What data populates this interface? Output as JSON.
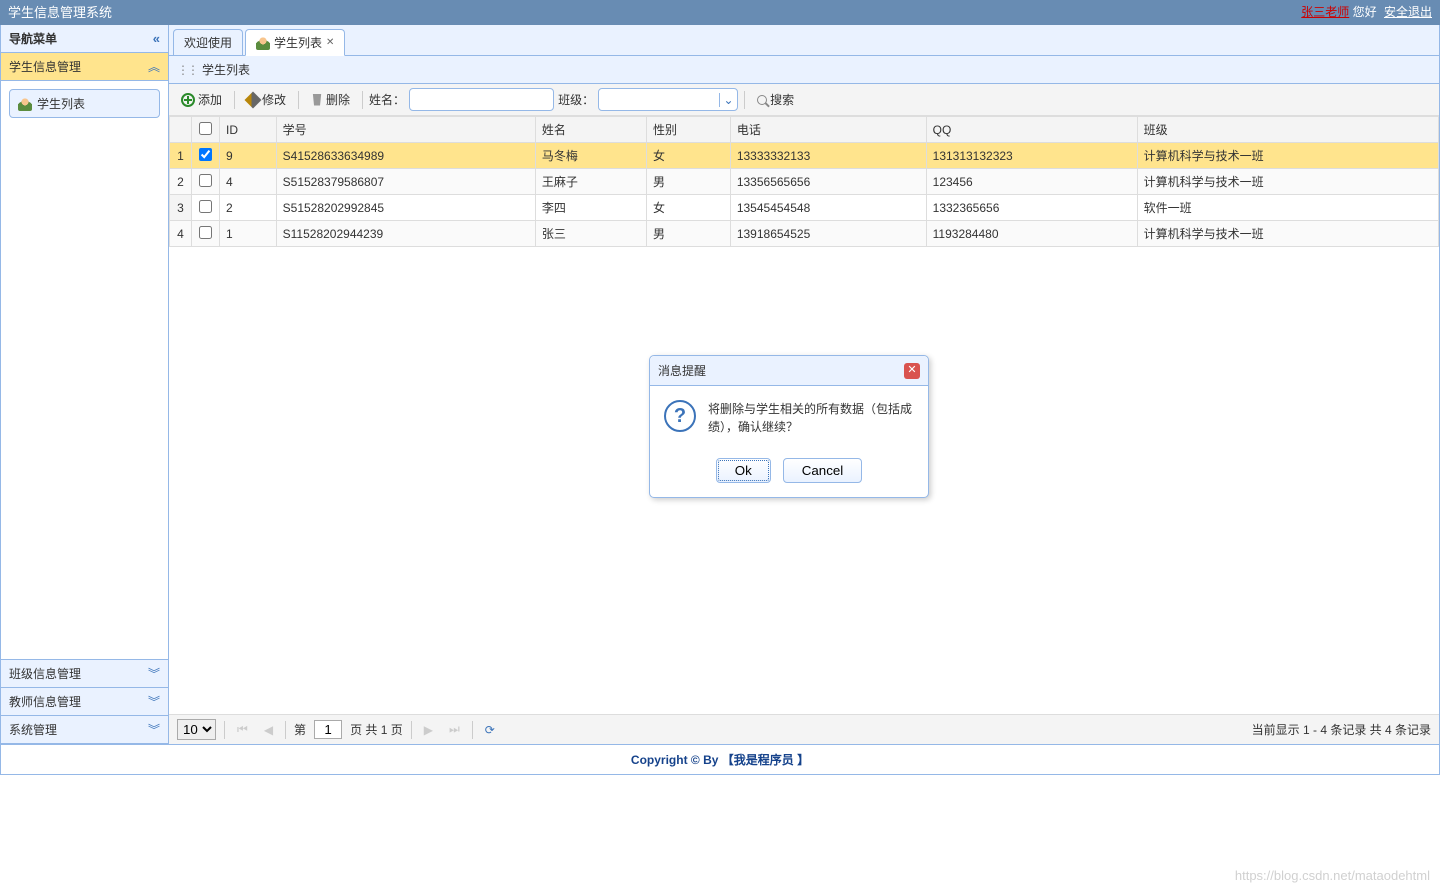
{
  "topbar": {
    "title": "学生信息管理系统",
    "teacher": "张三老师",
    "greeting": "您好",
    "logout": "安全退出"
  },
  "sidebar": {
    "header": "导航菜单",
    "sections": [
      {
        "label": "学生信息管理",
        "expanded": true,
        "items": [
          {
            "label": "学生列表"
          }
        ]
      },
      {
        "label": "班级信息管理",
        "expanded": false
      },
      {
        "label": "教师信息管理",
        "expanded": false
      },
      {
        "label": "系统管理",
        "expanded": false
      }
    ]
  },
  "tabs": {
    "items": [
      {
        "label": "欢迎使用",
        "closable": false,
        "icon": false
      },
      {
        "label": "学生列表",
        "closable": true,
        "icon": true
      }
    ],
    "active": 1
  },
  "panel": {
    "title": "学生列表"
  },
  "toolbar": {
    "add": "添加",
    "edit": "修改",
    "delete": "删除",
    "name_label": "姓名：",
    "class_label": "班级：",
    "search": "搜索"
  },
  "grid": {
    "columns": [
      "ID",
      "学号",
      "姓名",
      "性别",
      "电话",
      "QQ",
      "班级"
    ],
    "rows": [
      {
        "n": 1,
        "checked": true,
        "id": "9",
        "sn": "S41528633634989",
        "name": "马冬梅",
        "sex": "女",
        "tel": "13333332133",
        "qq": "131313132323",
        "cls": "计算机科学与技术一班"
      },
      {
        "n": 2,
        "checked": false,
        "id": "4",
        "sn": "S51528379586807",
        "name": "王麻子",
        "sex": "男",
        "tel": "13356565656",
        "qq": "123456",
        "cls": "计算机科学与技术一班"
      },
      {
        "n": 3,
        "checked": false,
        "id": "2",
        "sn": "S51528202992845",
        "name": "李四",
        "sex": "女",
        "tel": "13545454548",
        "qq": "1332365656",
        "cls": "软件一班"
      },
      {
        "n": 4,
        "checked": false,
        "id": "1",
        "sn": "S11528202944239",
        "name": "张三",
        "sex": "男",
        "tel": "13918654525",
        "qq": "1193284480",
        "cls": "计算机科学与技术一班"
      }
    ]
  },
  "pager": {
    "page_size": "10",
    "page_prefix": "第",
    "page": "1",
    "page_suffix": "页 共 1 页",
    "info": "当前显示 1 - 4 条记录 共 4 条记录"
  },
  "dialog": {
    "title": "消息提醒",
    "message": "将删除与学生相关的所有数据（包括成绩），确认继续？",
    "ok": "Ok",
    "cancel": "Cancel"
  },
  "footer": {
    "text": "Copyright © By 【我是程序员 】"
  },
  "watermark": "https://blog.csdn.net/mataodehtml"
}
